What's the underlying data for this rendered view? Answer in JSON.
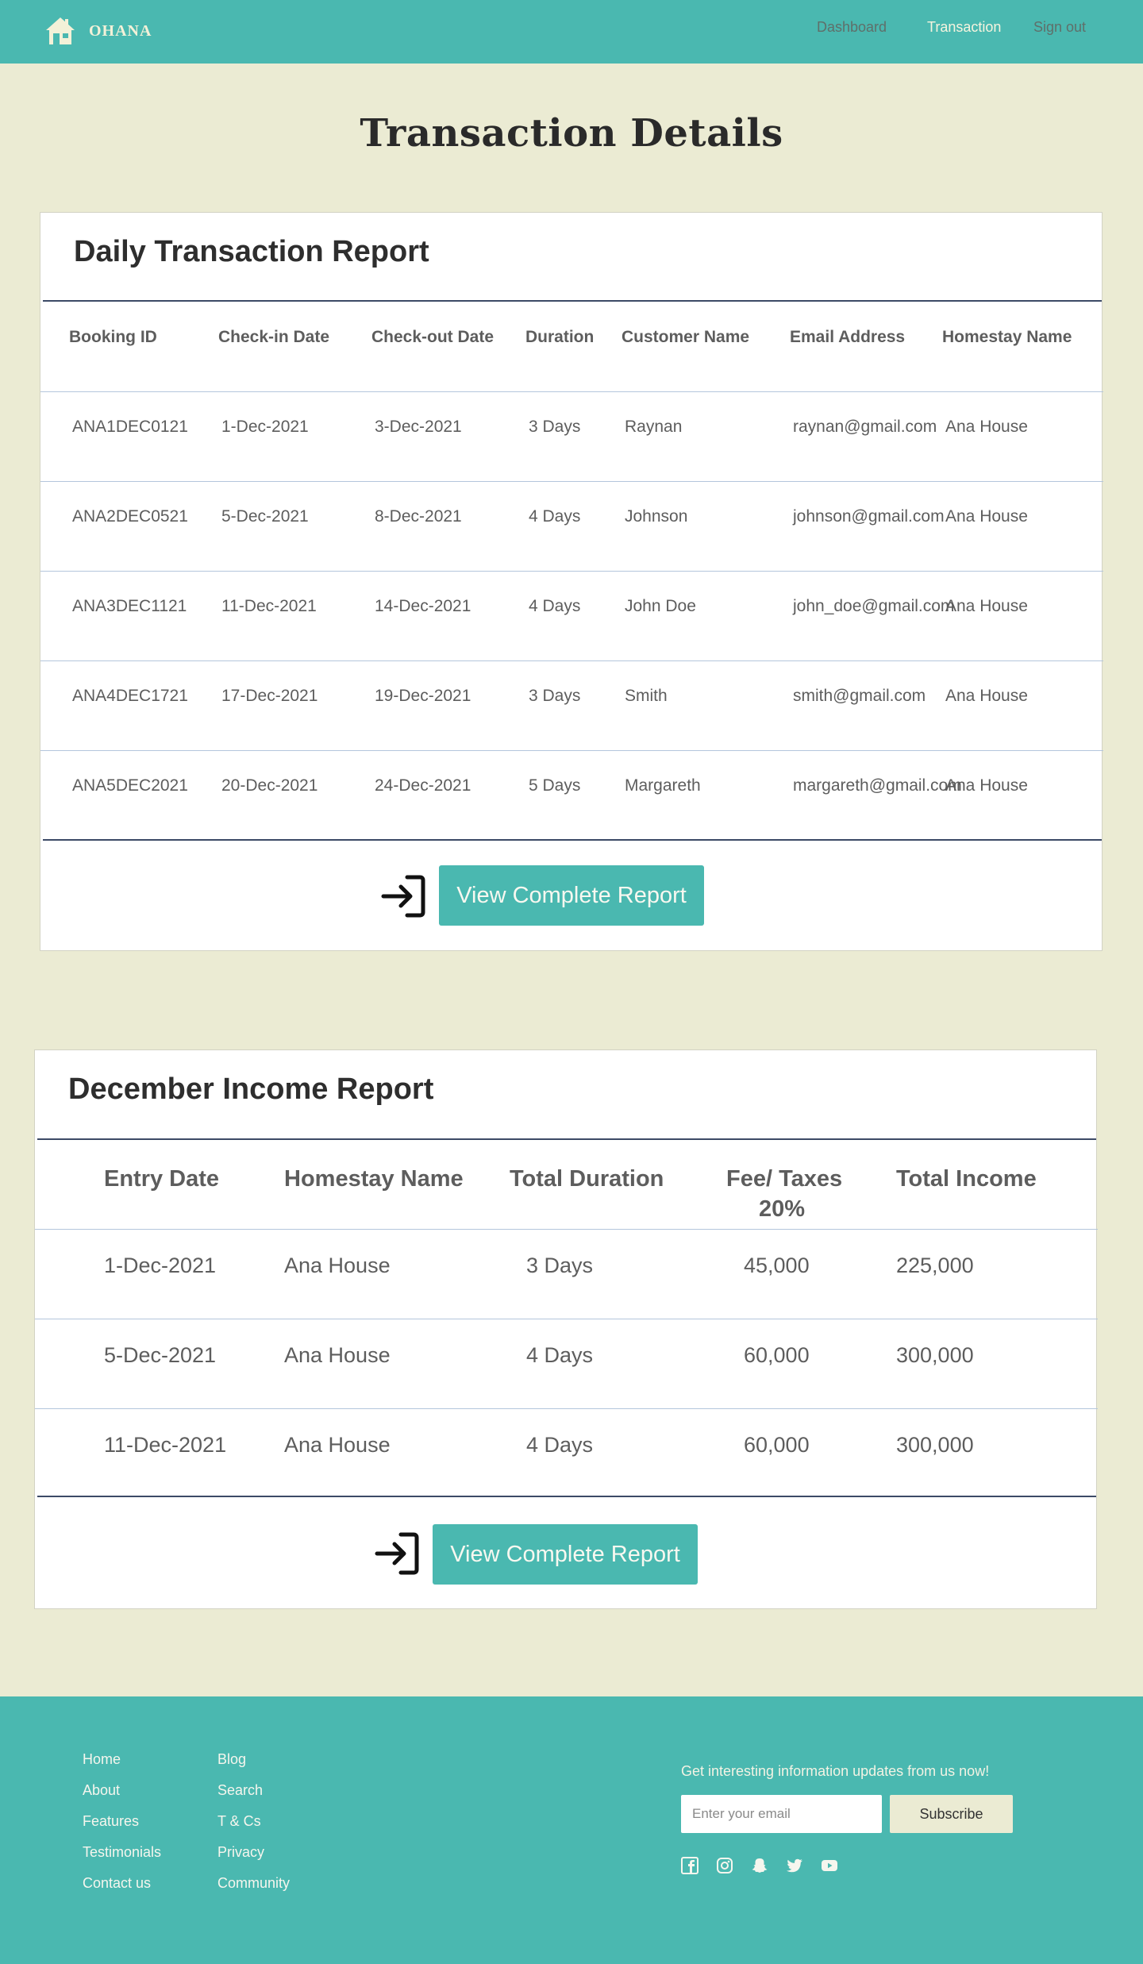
{
  "brand": {
    "name": "OHANA"
  },
  "nav": {
    "links": [
      {
        "label": "Dashboard",
        "active": false
      },
      {
        "label": "Transaction",
        "active": true
      },
      {
        "label": "Sign out",
        "active": false
      }
    ]
  },
  "page": {
    "title": "Transaction Details"
  },
  "daily_report": {
    "title": "Daily Transaction Report",
    "columns": [
      "Booking ID",
      "Check-in Date",
      "Check-out Date",
      "Duration",
      "Customer Name",
      "Email Address",
      "Homestay Name"
    ],
    "rows": [
      [
        "ANA1DEC0121",
        "1-Dec-2021",
        "3-Dec-2021",
        "3 Days",
        "Raynan",
        "raynan@gmail.com",
        "Ana House"
      ],
      [
        "ANA2DEC0521",
        "5-Dec-2021",
        "8-Dec-2021",
        "4 Days",
        "Johnson",
        "johnson@gmail.com",
        "Ana House"
      ],
      [
        "ANA3DEC1121",
        "11-Dec-2021",
        "14-Dec-2021",
        "4 Days",
        "John Doe",
        "john_doe@gmail.com",
        "Ana House"
      ],
      [
        "ANA4DEC1721",
        "17-Dec-2021",
        "19-Dec-2021",
        "3 Days",
        "Smith",
        "smith@gmail.com",
        "Ana House"
      ],
      [
        "ANA5DEC2021",
        "20-Dec-2021",
        "24-Dec-2021",
        "5 Days",
        "Margareth",
        "margareth@gmail.com",
        "Ana House"
      ]
    ],
    "button_label": "View Complete Report"
  },
  "income_report": {
    "title": "December Income Report",
    "columns": [
      "Entry Date",
      "Homestay Name",
      "Total Duration",
      "Fee/ Taxes",
      "Total Income"
    ],
    "fee_subheader": "20%",
    "rows": [
      [
        "1-Dec-2021",
        "Ana House",
        "3 Days",
        "45,000",
        "225,000"
      ],
      [
        "5-Dec-2021",
        "Ana House",
        "4 Days",
        "60,000",
        "300,000"
      ],
      [
        "11-Dec-2021",
        "Ana House",
        "4 Days",
        "60,000",
        "300,000"
      ]
    ],
    "button_label": "View Complete Report"
  },
  "footer": {
    "col1": [
      "Home",
      "About",
      "Features",
      "Testimonials",
      "Contact us"
    ],
    "col2": [
      "Blog",
      "Search",
      "T & Cs",
      "Privacy",
      "Community"
    ],
    "newsletter_text": "Get interesting information updates from us now!",
    "email_placeholder": "Enter your email",
    "subscribe_label": "Subscribe",
    "social_icons": [
      "facebook-icon",
      "instagram-icon",
      "snapchat-icon",
      "twitter-icon",
      "youtube-icon"
    ]
  },
  "colors": {
    "teal": "#4ab8b0",
    "cream": "#ebebd3",
    "rule_dark": "#3c4a66",
    "rule_light": "#b4c6dc"
  }
}
